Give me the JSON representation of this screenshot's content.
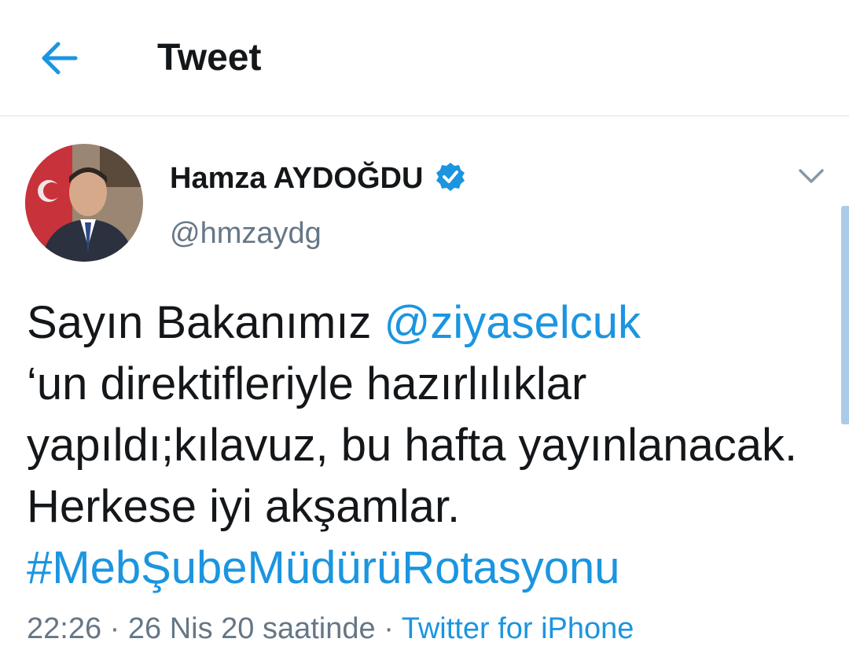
{
  "header": {
    "back_icon": "arrow-left-icon",
    "title": "Tweet"
  },
  "tweet": {
    "author": {
      "name": "Hamza AYDOĞDU",
      "handle": "@hmzaydg",
      "verified_icon": "verified-badge-icon"
    },
    "menu_icon": "chevron-down-icon",
    "text": {
      "intro": "Sayın Bakanımız ",
      "mention": "@ziyaselcuk",
      "line2": "‘un direktifleriyle hazırlılıklar",
      "line3": "yapıldı;kılavuz, bu hafta yayınlanacak.",
      "line4": "Herkese iyi akşamlar.",
      "hashtag": "#MebŞubeMüdürüRotasyonu"
    },
    "meta": {
      "time": "22:26",
      "sep1": " · ",
      "date": "26 Nis 20 saatinde",
      "sep2": " · ",
      "source": "Twitter for iPhone"
    }
  },
  "colors": {
    "accent": "#1b95e0",
    "text": "#14171a",
    "secondary": "#657786",
    "divider": "#d9e1e7"
  }
}
